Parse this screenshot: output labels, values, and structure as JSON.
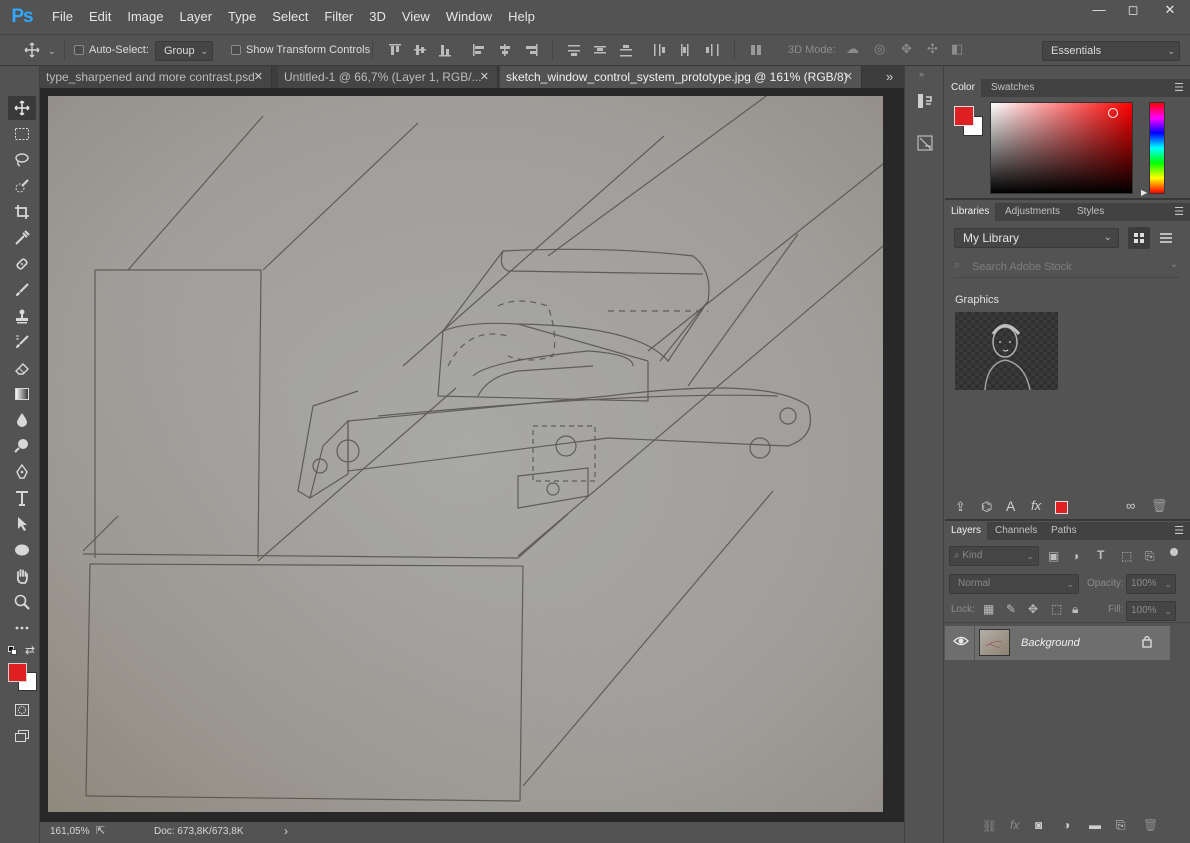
{
  "app": {
    "logo": "Ps"
  },
  "menu": [
    "File",
    "Edit",
    "Image",
    "Layer",
    "Type",
    "Select",
    "Filter",
    "3D",
    "View",
    "Window",
    "Help"
  ],
  "window_controls": {
    "minimize": "—",
    "maximize": "◻",
    "close": "✕"
  },
  "options": {
    "auto_select_label": "Auto-Select:",
    "auto_select_checked": false,
    "auto_select_target": "Group",
    "show_transform_label": "Show Transform Controls",
    "show_transform_checked": false,
    "mode_3d_label": "3D Mode:",
    "workspace": "Essentials"
  },
  "tabs": [
    {
      "label": "type_sharpened and more contrast.psd",
      "close": "✕",
      "active": false
    },
    {
      "label": "Untitled-1 @ 66,7% (Layer 1, RGB/...",
      "close": "✕",
      "active": false
    },
    {
      "label": "sketch_window_control_system_prototype.jpg @ 161% (RGB/8)",
      "close": "✕",
      "active": true
    }
  ],
  "tab_overflow": "»",
  "status": {
    "zoom": "161,05%",
    "doc": "Doc: 673,8K/673,8K",
    "arrow": "›"
  },
  "colors": {
    "foreground": "#e02020",
    "background": "#ffffff",
    "accent": "#31a8ff"
  },
  "color_panel": {
    "tabs": [
      "Color",
      "Swatches"
    ],
    "active_tab": "Color"
  },
  "libraries_panel": {
    "tabs": [
      "Libraries",
      "Adjustments",
      "Styles"
    ],
    "active_tab": "Libraries",
    "library": "My Library",
    "search_placeholder": "Search Adobe Stock",
    "section": "Graphics"
  },
  "layers_panel": {
    "tabs": [
      "Layers",
      "Channels",
      "Paths"
    ],
    "active_tab": "Layers",
    "filter": "Kind",
    "blend_mode": "Normal",
    "opacity_label": "Opacity:",
    "opacity": "100%",
    "lock_label": "Lock:",
    "fill_label": "Fill:",
    "fill": "100%",
    "layers": [
      {
        "name": "Background",
        "visible": true,
        "locked": true
      }
    ]
  }
}
